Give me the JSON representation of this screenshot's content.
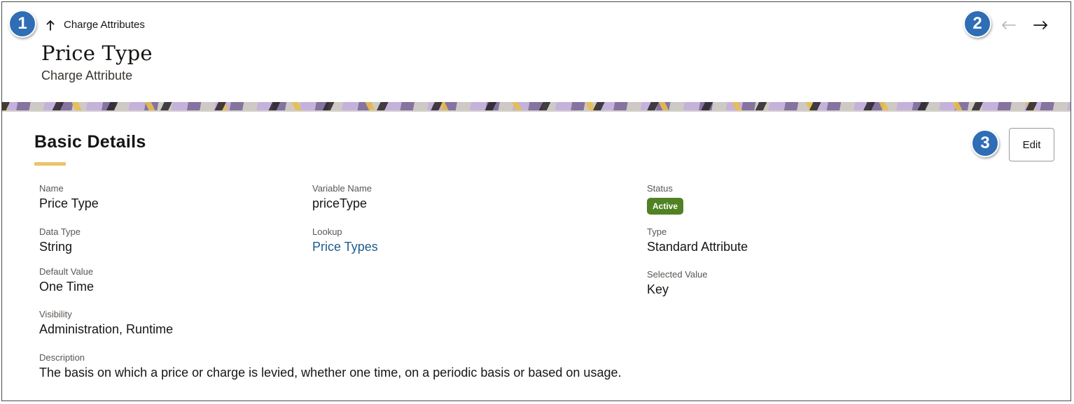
{
  "header": {
    "breadcrumb": "Charge Attributes",
    "title": "Price Type",
    "subtitle": "Charge Attribute"
  },
  "callouts": [
    "1",
    "2",
    "3"
  ],
  "section": {
    "title": "Basic Details",
    "edit_label": "Edit"
  },
  "fields": {
    "name": {
      "label": "Name",
      "value": "Price Type"
    },
    "variable_name": {
      "label": "Variable Name",
      "value": "priceType"
    },
    "status": {
      "label": "Status",
      "value": "Active",
      "color": "#508223"
    },
    "data_type": {
      "label": "Data Type",
      "value": "String"
    },
    "lookup": {
      "label": "Lookup",
      "value": "Price Types"
    },
    "type": {
      "label": "Type",
      "value": "Standard Attribute"
    },
    "default_value": {
      "label": "Default Value",
      "value": "One Time"
    },
    "selected_value": {
      "label": "Selected Value",
      "value": "Key"
    },
    "visibility": {
      "label": "Visibility",
      "value": "Administration, Runtime"
    },
    "description": {
      "label": "Description",
      "value": "The basis on which a price or charge is levied, whether one time, on a periodic basis or based on usage."
    }
  },
  "icons": {
    "breadcrumb": "arrow-up-icon",
    "prev": "arrow-left-icon",
    "next": "arrow-right-icon"
  },
  "colors": {
    "callout": "#2f6db5",
    "link": "#1e5c8c",
    "accent_underline": "#e9c46a"
  }
}
